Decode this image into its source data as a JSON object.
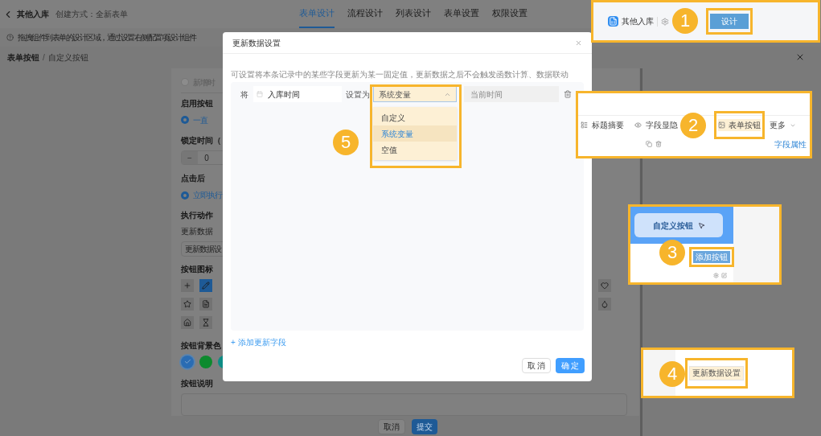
{
  "header": {
    "title": "其他入库",
    "meta": "创建方式：全新表单",
    "tabs": [
      {
        "label": "表单设计",
        "selected": true
      },
      {
        "label": "流程设计",
        "selected": false
      },
      {
        "label": "列表设计",
        "selected": false
      },
      {
        "label": "表单设置",
        "selected": false
      },
      {
        "label": "权限设置",
        "selected": false
      }
    ]
  },
  "hint": "拖拽组件到表单的设计区域，通过设置右侧配置项设计组件",
  "breadcrumb": {
    "title": "表单按钮",
    "separator": "/",
    "current": "自定义按钮"
  },
  "panel": {
    "trigger_option": {
      "label": "新增时",
      "checked": false
    },
    "enable": {
      "title": "启用按钮",
      "option": {
        "label": "一直",
        "checked": true
      }
    },
    "lock": {
      "title": "锁定时间（",
      "minus": "−",
      "value": "0"
    },
    "after_click": {
      "title": "点击后",
      "option": {
        "label": "立即执行",
        "checked": true
      }
    },
    "action": {
      "title": "执行动作",
      "label": "更新数据",
      "button": "更新数据设"
    },
    "icons": {
      "title": "按钮图标",
      "rows": [
        {
          "items": [
            {
              "selected": false
            },
            {
              "selected": true
            }
          ],
          "end": {
            "selected": false
          }
        },
        {
          "items": [
            {
              "selected": false
            },
            {
              "selected": false
            }
          ],
          "end": {
            "selected": false
          }
        },
        {
          "items": [
            {
              "selected": false
            },
            {
              "selected": false
            }
          ]
        }
      ]
    },
    "colors": {
      "title": "按钮背景色",
      "swatches": [
        {
          "color": "#2a6cb3",
          "selected": true
        },
        {
          "color": "#0d8a2e",
          "selected": false
        },
        {
          "color": "#0e8c85",
          "selected": false
        }
      ]
    },
    "description": {
      "title": "按钮说明"
    }
  },
  "footer": {
    "buttons": [
      {
        "label": "取消",
        "kind": "default"
      },
      {
        "label": "提交",
        "kind": "primary"
      }
    ]
  },
  "dialog": {
    "title": "更新数据设置",
    "description": "可设置将本条记录中的某些字段更新为某一固定值，更新数据之后不会触发函数计算、数据联动",
    "row": {
      "prefix": "将",
      "field": "入库时间",
      "middle": "设置为",
      "select": "系统变量",
      "expanded": true,
      "value_placeholder": "当前时间"
    },
    "options": [
      {
        "label": "自定义",
        "selected": false
      },
      {
        "label": "系统变量",
        "selected": true
      },
      {
        "label": "空值",
        "selected": false
      }
    ],
    "add_link": "+ 添加更新字段",
    "buttons": [
      {
        "label": "取 消",
        "kind": "default"
      },
      {
        "label": "确 定",
        "kind": "primary"
      }
    ],
    "step": "5"
  },
  "callouts": [
    {
      "step": "1",
      "app_title": "其他入库",
      "button": "设计"
    },
    {
      "step": "2",
      "tools": [
        "标题摘要",
        "字段显隐"
      ],
      "button": "表单按钮",
      "more": "更多",
      "tab": "字段属性"
    },
    {
      "step": "3",
      "preview_button": "自定义按钮",
      "button": "添加按钮"
    },
    {
      "step": "4",
      "button": "更新数据设置"
    }
  ]
}
